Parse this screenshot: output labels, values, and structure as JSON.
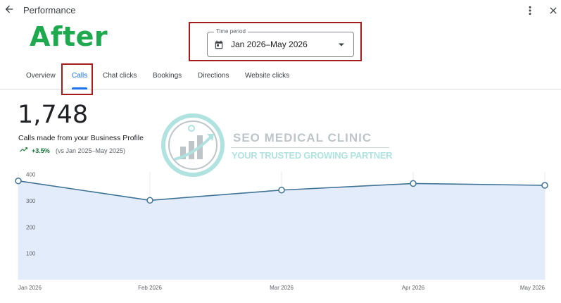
{
  "header": {
    "title": "Performance"
  },
  "badge": {
    "text": "After"
  },
  "time_period": {
    "legend": "Time period",
    "value": "Jan 2026–May 2026"
  },
  "tabs": [
    {
      "label": "Overview",
      "active": false
    },
    {
      "label": "Calls",
      "active": true
    },
    {
      "label": "Chat clicks",
      "active": false
    },
    {
      "label": "Bookings",
      "active": false
    },
    {
      "label": "Directions",
      "active": false
    },
    {
      "label": "Website clicks",
      "active": false
    }
  ],
  "metric": {
    "value": "1,748",
    "description": "Calls made from your Business Profile",
    "change": "+3.5%",
    "comparison": "(vs Jan 2025–May 2025)"
  },
  "watermark": {
    "title": "SEO MEDICAL CLINIC",
    "tagline": "YOUR TRUSTED GROWING PARTNER"
  },
  "colors": {
    "accent": "#1a73e8",
    "positive": "#137333",
    "highlight": "#a61c1c",
    "badge": "#1ea94e",
    "area_fill": "#e3ecfb",
    "line": "#3f7396"
  },
  "icons": {
    "back": "arrow-left-icon",
    "more": "more-vert-icon",
    "close": "close-icon",
    "calendar": "calendar-icon",
    "dropdown": "dropdown-arrow-icon",
    "trend": "trending-up-icon"
  },
  "chart_data": {
    "type": "area",
    "x": [
      "Jan 2026",
      "Feb 2026",
      "Mar 2026",
      "Apr 2026",
      "May 2026"
    ],
    "series": [
      {
        "values": [
          376,
          302,
          341,
          366,
          359
        ]
      }
    ],
    "yticks": [
      100,
      200,
      300,
      400
    ],
    "ylim": [
      0,
      410
    ],
    "grid": true
  }
}
